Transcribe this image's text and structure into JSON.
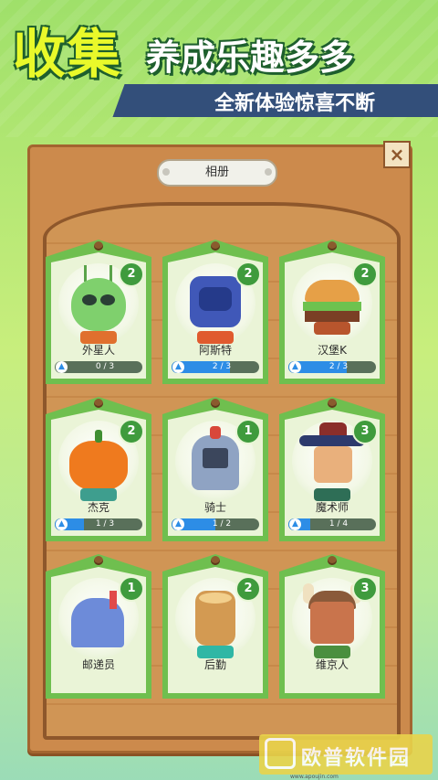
{
  "banner": {
    "title_big": "收集",
    "title_rest": "养成乐趣多多",
    "subtitle": "全新体验惊喜不断"
  },
  "album": {
    "tab_label": "相册",
    "close_label": "×"
  },
  "cards": [
    {
      "name": "外星人",
      "level": "2",
      "progress_text": "0 / 3",
      "progress": 0.0
    },
    {
      "name": "阿斯特",
      "level": "2",
      "progress_text": "2 / 3",
      "progress": 0.667
    },
    {
      "name": "汉堡K",
      "level": "2",
      "progress_text": "2 / 3",
      "progress": 0.667
    },
    {
      "name": "杰克",
      "level": "2",
      "progress_text": "1 / 3",
      "progress": 0.333
    },
    {
      "name": "骑士",
      "level": "1",
      "progress_text": "1 / 2",
      "progress": 0.5
    },
    {
      "name": "魔术师",
      "level": "3",
      "progress_text": "1 / 4",
      "progress": 0.25
    },
    {
      "name": "邮递员",
      "level": "1",
      "progress_text": "",
      "progress": 0.0
    },
    {
      "name": "后勤",
      "level": "2",
      "progress_text": "",
      "progress": 0.0
    },
    {
      "name": "维京人",
      "level": "3",
      "progress_text": "",
      "progress": 0.0
    }
  ],
  "watermark": {
    "text": "欧普软件园",
    "url": "www.apoujin.com"
  },
  "colors": {
    "card_green": "#6fbf4f",
    "level_badge": "#3f9b3d",
    "progress_fill": "#2d8de6",
    "wood": "#cc8a4c"
  }
}
